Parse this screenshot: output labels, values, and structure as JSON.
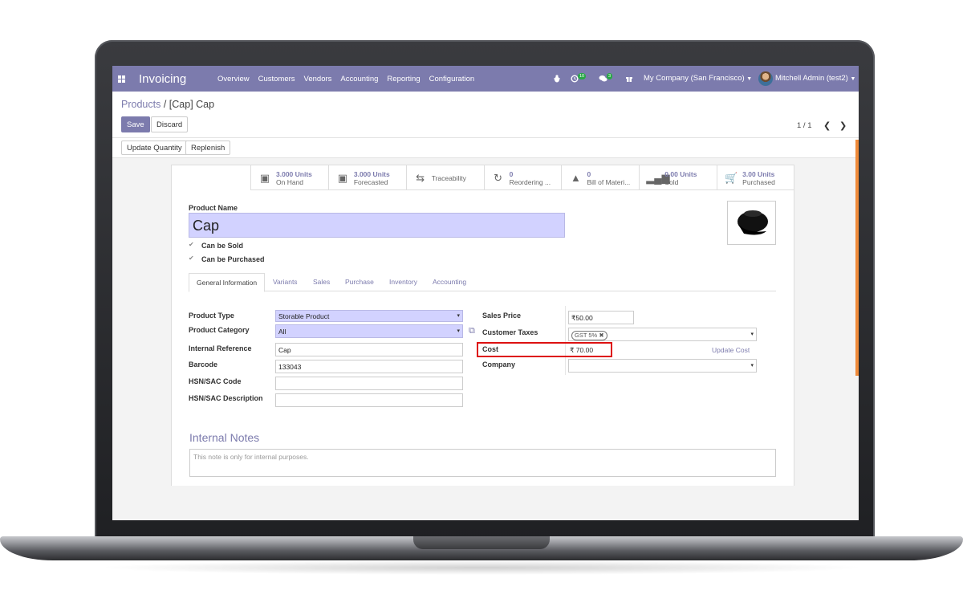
{
  "navbar": {
    "app_title": "Invoicing",
    "menu": [
      "Overview",
      "Customers",
      "Vendors",
      "Accounting",
      "Reporting",
      "Configuration"
    ],
    "activity_count": "10",
    "messages_count": "3",
    "company": "My Company (San Francisco)",
    "user": "Mitchell Admin (test2)",
    "accent_color": "#7c7bad"
  },
  "breadcrumb": {
    "parent": "Products",
    "separator": "/",
    "current": "[Cap] Cap"
  },
  "buttons": {
    "save": "Save",
    "discard": "Discard",
    "update_quantity": "Update Quantity",
    "replenish": "Replenish"
  },
  "pager": {
    "value": "1 / 1"
  },
  "smart_buttons": [
    {
      "icon": "cubes-icon",
      "value": "3.000 Units",
      "label": "On Hand"
    },
    {
      "icon": "cubes-icon",
      "value": "3.000 Units",
      "label": "Forecasted"
    },
    {
      "icon": "exchange-icon",
      "value": "",
      "label": "Traceability"
    },
    {
      "icon": "refresh-icon",
      "value": "0",
      "label": "Reordering ..."
    },
    {
      "icon": "flask-icon",
      "value": "0",
      "label": "Bill of Materi..."
    },
    {
      "icon": "signal-icon",
      "value": "0.00 Units",
      "label": "Sold"
    },
    {
      "icon": "shopping-cart-icon",
      "value": "3.00 Units",
      "label": "Purchased"
    }
  ],
  "form": {
    "product_name_label": "Product Name",
    "product_name": "Cap",
    "can_be_sold": "Can be Sold",
    "can_be_purchased": "Can be Purchased",
    "tabs": [
      "General Information",
      "Variants",
      "Sales",
      "Purchase",
      "Inventory",
      "Accounting"
    ],
    "left_fields": {
      "product_type_label": "Product Type",
      "product_type": "Storable Product",
      "product_category_label": "Product Category",
      "product_category": "All",
      "internal_reference_label": "Internal Reference",
      "internal_reference": "Cap",
      "barcode_label": "Barcode",
      "barcode": "133043",
      "hsn_code_label": "HSN/SAC Code",
      "hsn_code": "",
      "hsn_description_label": "HSN/SAC Description",
      "hsn_description": ""
    },
    "right_fields": {
      "sales_price_label": "Sales Price",
      "sales_price": "₹50.00",
      "customer_taxes_label": "Customer Taxes",
      "customer_tax_tag": "GST 5%",
      "cost_label": "Cost",
      "cost": "₹ 70.00",
      "update_cost": "Update Cost",
      "company_label": "Company",
      "company": ""
    },
    "internal_notes_title": "Internal Notes",
    "internal_notes_placeholder": "This note is only for internal purposes."
  }
}
